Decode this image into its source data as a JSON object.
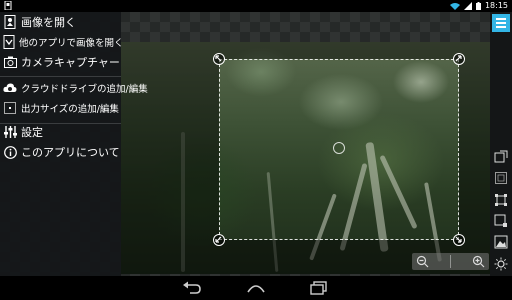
{
  "status_bar": {
    "time": "18:15"
  },
  "menu": {
    "items": [
      {
        "label": "画像を開く",
        "icon": "image-open-icon"
      },
      {
        "label": "他のアプリで画像を開く",
        "icon": "open-with-app-icon"
      },
      {
        "label": "カメラキャプチャー",
        "icon": "camera-icon"
      },
      {
        "label": "クラウドドライブの追加/編集",
        "icon": "cloud-drive-icon"
      },
      {
        "label": "出力サイズの追加/編集",
        "icon": "output-size-icon"
      },
      {
        "label": "設定",
        "icon": "settings-sliders-icon"
      },
      {
        "label": "このアプリについて",
        "icon": "info-icon"
      }
    ]
  },
  "right_toolbar": {
    "tools": [
      "crop-frame-icon",
      "aspect-ratio-icon",
      "fit-frame-icon",
      "expand-frame-icon",
      "image-icon",
      "brightness-icon"
    ]
  },
  "colors": {
    "accent": "#33b5e5"
  }
}
